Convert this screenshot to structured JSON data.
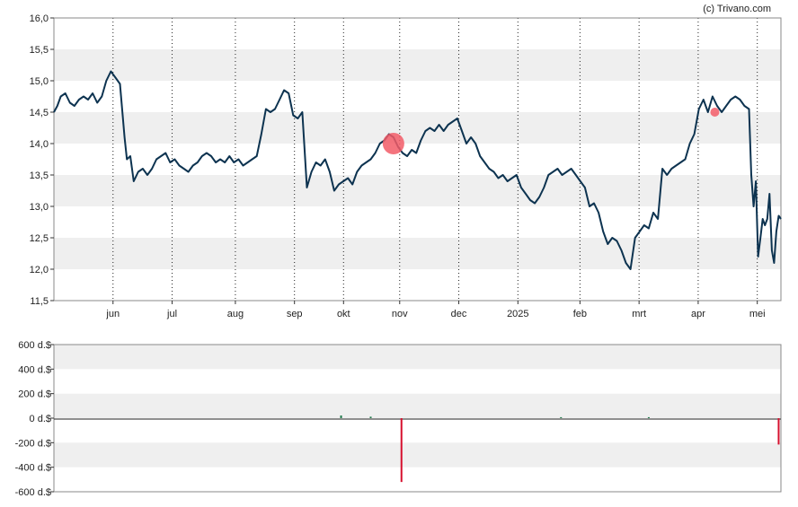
{
  "credit": "(c) Trivano.com",
  "colors": {
    "line": "#0d3350",
    "band": "#efefef",
    "buy": "#1f7a4a",
    "sell": "#d6102e",
    "marker": "#f25c67"
  },
  "chart_data": [
    {
      "type": "line",
      "name": "price",
      "ylim": [
        11.5,
        16.0
      ],
      "y_ticks": [
        "11,5",
        "12,0",
        "12,5",
        "13,0",
        "13,5",
        "14,0",
        "14,5",
        "15,0",
        "15,5",
        "16,0"
      ],
      "x_ticks": [
        "jun",
        "jul",
        "aug",
        "sep",
        "okt",
        "nov",
        "dec",
        "2025",
        "feb",
        "mrt",
        "apr",
        "mei"
      ],
      "x_tick_index": [
        1.0,
        2.0,
        3.07,
        4.07,
        4.9,
        5.85,
        6.85,
        7.85,
        8.9,
        9.9,
        10.9,
        11.9
      ],
      "series": [
        {
          "values": [
            [
              0.0,
              14.5
            ],
            [
              0.03,
              14.6
            ],
            [
              0.06,
              14.75
            ],
            [
              0.1,
              14.8
            ],
            [
              0.14,
              14.65
            ],
            [
              0.18,
              14.6
            ],
            [
              0.22,
              14.7
            ],
            [
              0.26,
              14.75
            ],
            [
              0.3,
              14.7
            ],
            [
              0.34,
              14.8
            ],
            [
              0.38,
              14.65
            ],
            [
              0.42,
              14.75
            ],
            [
              0.46,
              15.0
            ],
            [
              0.5,
              15.15
            ],
            [
              0.54,
              15.05
            ],
            [
              0.58,
              14.95
            ],
            [
              0.62,
              14.1
            ],
            [
              0.64,
              13.75
            ],
            [
              0.67,
              13.8
            ],
            [
              0.7,
              13.4
            ],
            [
              0.74,
              13.55
            ],
            [
              0.78,
              13.6
            ],
            [
              0.82,
              13.5
            ],
            [
              0.86,
              13.6
            ],
            [
              0.9,
              13.75
            ],
            [
              0.94,
              13.8
            ],
            [
              0.98,
              13.85
            ],
            [
              1.02,
              13.7
            ],
            [
              1.06,
              13.75
            ],
            [
              1.1,
              13.65
            ],
            [
              1.14,
              13.6
            ],
            [
              1.18,
              13.55
            ],
            [
              1.22,
              13.65
            ],
            [
              1.26,
              13.7
            ],
            [
              1.3,
              13.8
            ],
            [
              1.34,
              13.85
            ],
            [
              1.38,
              13.8
            ],
            [
              1.42,
              13.7
            ],
            [
              1.46,
              13.75
            ],
            [
              1.5,
              13.7
            ],
            [
              1.54,
              13.8
            ],
            [
              1.58,
              13.7
            ],
            [
              1.62,
              13.75
            ],
            [
              1.66,
              13.65
            ],
            [
              1.7,
              13.7
            ],
            [
              1.74,
              13.75
            ],
            [
              1.78,
              13.8
            ],
            [
              1.82,
              14.15
            ],
            [
              1.86,
              14.55
            ],
            [
              1.9,
              14.5
            ],
            [
              1.94,
              14.55
            ],
            [
              1.98,
              14.7
            ],
            [
              2.02,
              14.85
            ],
            [
              2.06,
              14.8
            ],
            [
              2.1,
              14.45
            ],
            [
              2.14,
              14.4
            ],
            [
              2.18,
              14.5
            ],
            [
              2.22,
              13.3
            ],
            [
              2.26,
              13.55
            ],
            [
              2.3,
              13.7
            ],
            [
              2.34,
              13.65
            ],
            [
              2.38,
              13.75
            ],
            [
              2.42,
              13.55
            ],
            [
              2.46,
              13.25
            ],
            [
              2.5,
              13.35
            ],
            [
              2.54,
              13.4
            ],
            [
              2.58,
              13.45
            ],
            [
              2.62,
              13.35
            ],
            [
              2.66,
              13.55
            ],
            [
              2.7,
              13.65
            ],
            [
              2.74,
              13.7
            ],
            [
              2.78,
              13.75
            ],
            [
              2.82,
              13.85
            ],
            [
              2.86,
              14.0
            ],
            [
              2.9,
              14.05
            ],
            [
              2.94,
              14.15
            ],
            [
              2.98,
              14.1
            ],
            [
              3.02,
              13.95
            ],
            [
              3.06,
              13.85
            ],
            [
              3.1,
              13.8
            ],
            [
              3.14,
              13.9
            ],
            [
              3.18,
              13.85
            ],
            [
              3.22,
              14.05
            ],
            [
              3.26,
              14.2
            ],
            [
              3.3,
              14.25
            ],
            [
              3.34,
              14.2
            ],
            [
              3.38,
              14.3
            ],
            [
              3.42,
              14.2
            ],
            [
              3.46,
              14.3
            ],
            [
              3.5,
              14.35
            ],
            [
              3.54,
              14.4
            ],
            [
              3.58,
              14.2
            ],
            [
              3.62,
              14.0
            ],
            [
              3.66,
              14.1
            ],
            [
              3.7,
              14.0
            ],
            [
              3.74,
              13.8
            ],
            [
              3.78,
              13.7
            ],
            [
              3.82,
              13.6
            ],
            [
              3.86,
              13.55
            ],
            [
              3.9,
              13.45
            ],
            [
              3.94,
              13.5
            ],
            [
              3.98,
              13.4
            ],
            [
              4.02,
              13.45
            ],
            [
              4.06,
              13.5
            ],
            [
              4.1,
              13.3
            ],
            [
              4.14,
              13.2
            ],
            [
              4.18,
              13.1
            ],
            [
              4.22,
              13.05
            ],
            [
              4.26,
              13.15
            ],
            [
              4.3,
              13.3
            ],
            [
              4.34,
              13.5
            ],
            [
              4.38,
              13.55
            ],
            [
              4.42,
              13.6
            ],
            [
              4.46,
              13.5
            ],
            [
              4.5,
              13.55
            ],
            [
              4.54,
              13.6
            ],
            [
              4.58,
              13.5
            ],
            [
              4.62,
              13.4
            ],
            [
              4.66,
              13.3
            ],
            [
              4.7,
              13.0
            ],
            [
              4.74,
              13.05
            ],
            [
              4.78,
              12.9
            ],
            [
              4.82,
              12.6
            ],
            [
              4.86,
              12.4
            ],
            [
              4.9,
              12.5
            ],
            [
              4.94,
              12.45
            ],
            [
              4.98,
              12.3
            ],
            [
              5.02,
              12.1
            ],
            [
              5.06,
              12.0
            ],
            [
              5.1,
              12.5
            ],
            [
              5.14,
              12.6
            ],
            [
              5.18,
              12.7
            ],
            [
              5.22,
              12.65
            ],
            [
              5.26,
              12.9
            ],
            [
              5.3,
              12.8
            ],
            [
              5.34,
              13.6
            ],
            [
              5.38,
              13.5
            ],
            [
              5.42,
              13.6
            ],
            [
              5.46,
              13.65
            ],
            [
              5.5,
              13.7
            ],
            [
              5.54,
              13.75
            ],
            [
              5.58,
              14.0
            ],
            [
              5.62,
              14.15
            ],
            [
              5.66,
              14.55
            ],
            [
              5.7,
              14.7
            ],
            [
              5.74,
              14.5
            ],
            [
              5.78,
              14.75
            ],
            [
              5.82,
              14.6
            ],
            [
              5.86,
              14.5
            ],
            [
              5.9,
              14.6
            ],
            [
              5.94,
              14.7
            ],
            [
              5.98,
              14.75
            ],
            [
              6.02,
              14.7
            ],
            [
              6.06,
              14.6
            ],
            [
              6.1,
              14.55
            ],
            [
              6.12,
              13.5
            ],
            [
              6.14,
              13.0
            ],
            [
              6.16,
              13.4
            ],
            [
              6.18,
              12.2
            ],
            [
              6.2,
              12.5
            ],
            [
              6.22,
              12.8
            ],
            [
              6.24,
              12.7
            ],
            [
              6.26,
              12.8
            ],
            [
              6.28,
              13.2
            ],
            [
              6.3,
              12.3
            ],
            [
              6.32,
              12.1
            ],
            [
              6.34,
              12.6
            ],
            [
              6.36,
              12.85
            ],
            [
              6.38,
              12.8
            ]
          ]
        }
      ],
      "markers": [
        {
          "x": 2.98,
          "y": 14.0,
          "size": "large"
        },
        {
          "x": 5.8,
          "y": 14.5,
          "size": "small"
        }
      ]
    },
    {
      "type": "bar",
      "name": "insider-transactions",
      "ylim": [
        -600,
        600
      ],
      "y_ticks": [
        "-600 d.$",
        "-400 d.$",
        "-200 d.$",
        "0 d.$",
        "200 d.$",
        "400 d.$",
        "600 d.$"
      ],
      "values": [
        {
          "x": 2.52,
          "y": 22,
          "kind": "buy"
        },
        {
          "x": 2.78,
          "y": 12,
          "kind": "buy"
        },
        {
          "x": 3.05,
          "y": -520,
          "kind": "sell"
        },
        {
          "x": 4.45,
          "y": 8,
          "kind": "buy"
        },
        {
          "x": 5.22,
          "y": 8,
          "kind": "buy"
        },
        {
          "x": 6.36,
          "y": -215,
          "kind": "sell"
        },
        {
          "x": 6.95,
          "y": 45,
          "kind": "buy"
        }
      ]
    }
  ]
}
